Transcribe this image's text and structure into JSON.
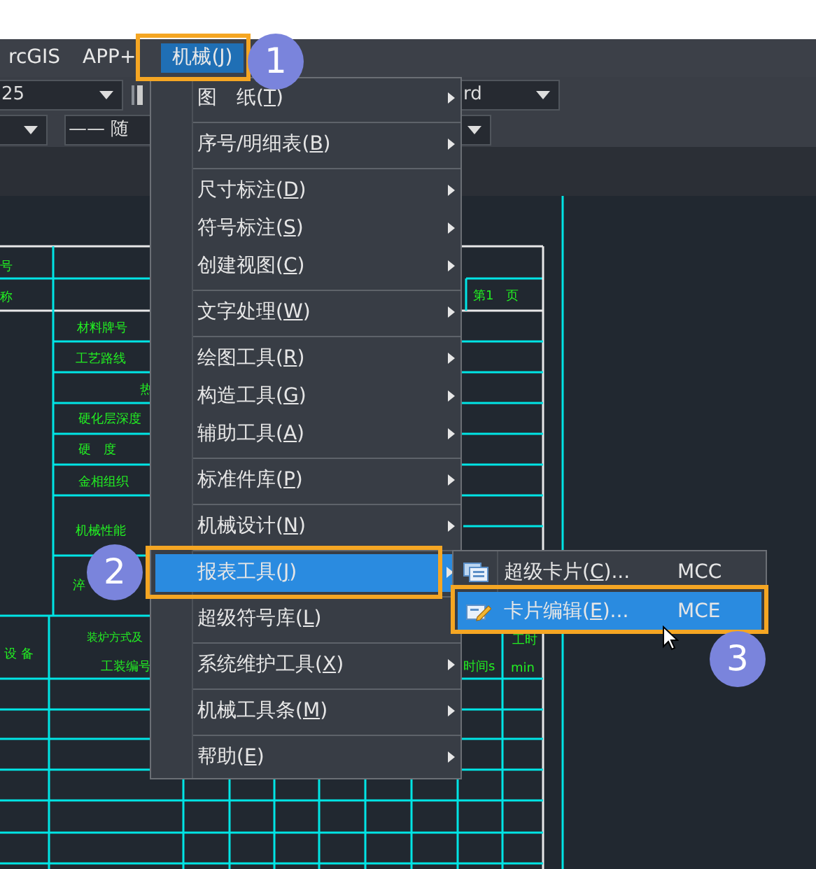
{
  "menubar": [
    {
      "label": "rcGIS",
      "selected": false
    },
    {
      "label": "APP+",
      "selected": false
    },
    {
      "label": "机械(J)",
      "selected": true
    }
  ],
  "toolbar": {
    "row_1": [
      {
        "value": "25"
      },
      {
        "value": "rd"
      }
    ],
    "row_2": [
      {
        "value": "—— 随"
      }
    ]
  },
  "drawing_texts": [
    {
      "text": "号"
    },
    {
      "text": "称"
    },
    {
      "text": "材料牌号"
    },
    {
      "text": "工艺路线"
    },
    {
      "text": "热"
    },
    {
      "text": "硬化层深度"
    },
    {
      "text": "硬　度"
    },
    {
      "text": "金相组织"
    },
    {
      "text": "机械性能"
    },
    {
      "text": "淬"
    },
    {
      "text": "第1　页"
    },
    {
      "text": "设 备"
    },
    {
      "text": "装炉方式及"
    },
    {
      "text": "工装编号"
    },
    {
      "text": "时间s"
    },
    {
      "text": "工时"
    },
    {
      "text": "min"
    }
  ],
  "menu": [
    {
      "kind": "item",
      "before": "图　纸(",
      "key": "T",
      "after": ")",
      "submenu": true,
      "selected": false
    },
    {
      "kind": "separator"
    },
    {
      "kind": "item",
      "before": "序号/明细表(",
      "key": "B",
      "after": ")",
      "submenu": true,
      "selected": false
    },
    {
      "kind": "separator"
    },
    {
      "kind": "item",
      "before": "尺寸标注(",
      "key": "D",
      "after": ")",
      "submenu": true,
      "selected": false
    },
    {
      "kind": "item",
      "before": "符号标注(",
      "key": "S",
      "after": ")",
      "submenu": true,
      "selected": false
    },
    {
      "kind": "item",
      "before": "创建视图(",
      "key": "C",
      "after": ")",
      "submenu": true,
      "selected": false
    },
    {
      "kind": "separator"
    },
    {
      "kind": "item",
      "before": "文字处理(",
      "key": "W",
      "after": ")",
      "submenu": true,
      "selected": false
    },
    {
      "kind": "separator"
    },
    {
      "kind": "item",
      "before": "绘图工具(",
      "key": "R",
      "after": ")",
      "submenu": true,
      "selected": false
    },
    {
      "kind": "item",
      "before": "构造工具(",
      "key": "G",
      "after": ")",
      "submenu": true,
      "selected": false
    },
    {
      "kind": "item",
      "before": "辅助工具(",
      "key": "A",
      "after": ")",
      "submenu": true,
      "selected": false
    },
    {
      "kind": "separator"
    },
    {
      "kind": "item",
      "before": "标准件库(",
      "key": "P",
      "after": ")",
      "submenu": true,
      "selected": false
    },
    {
      "kind": "separator"
    },
    {
      "kind": "item",
      "before": "机械设计(",
      "key": "N",
      "after": ")",
      "submenu": true,
      "selected": false
    },
    {
      "kind": "separator"
    },
    {
      "kind": "item",
      "before": "报表工具(",
      "key": "J",
      "after": ")",
      "submenu": true,
      "selected": true
    },
    {
      "kind": "separator"
    },
    {
      "kind": "item",
      "before": "超级符号库(",
      "key": "L",
      "after": ")",
      "submenu": false,
      "selected": false
    },
    {
      "kind": "separator"
    },
    {
      "kind": "item",
      "before": "系统维护工具(",
      "key": "X",
      "after": ")",
      "submenu": true,
      "selected": false
    },
    {
      "kind": "separator"
    },
    {
      "kind": "item",
      "before": "机械工具条(",
      "key": "M",
      "after": ")",
      "submenu": true,
      "selected": false
    },
    {
      "kind": "separator"
    },
    {
      "kind": "item",
      "before": "帮助(",
      "key": "E",
      "after": ")",
      "submenu": true,
      "selected": false
    }
  ],
  "submenu": [
    {
      "before": "超级卡片(",
      "key": "C",
      "after": ")...",
      "shortcut": "MCC",
      "selected": false
    },
    {
      "before": "卡片编辑(",
      "key": "E",
      "after": ")...",
      "shortcut": "MCE",
      "selected": true
    }
  ],
  "callouts": [
    {
      "number": "1"
    },
    {
      "number": "2"
    },
    {
      "number": "3"
    }
  ]
}
